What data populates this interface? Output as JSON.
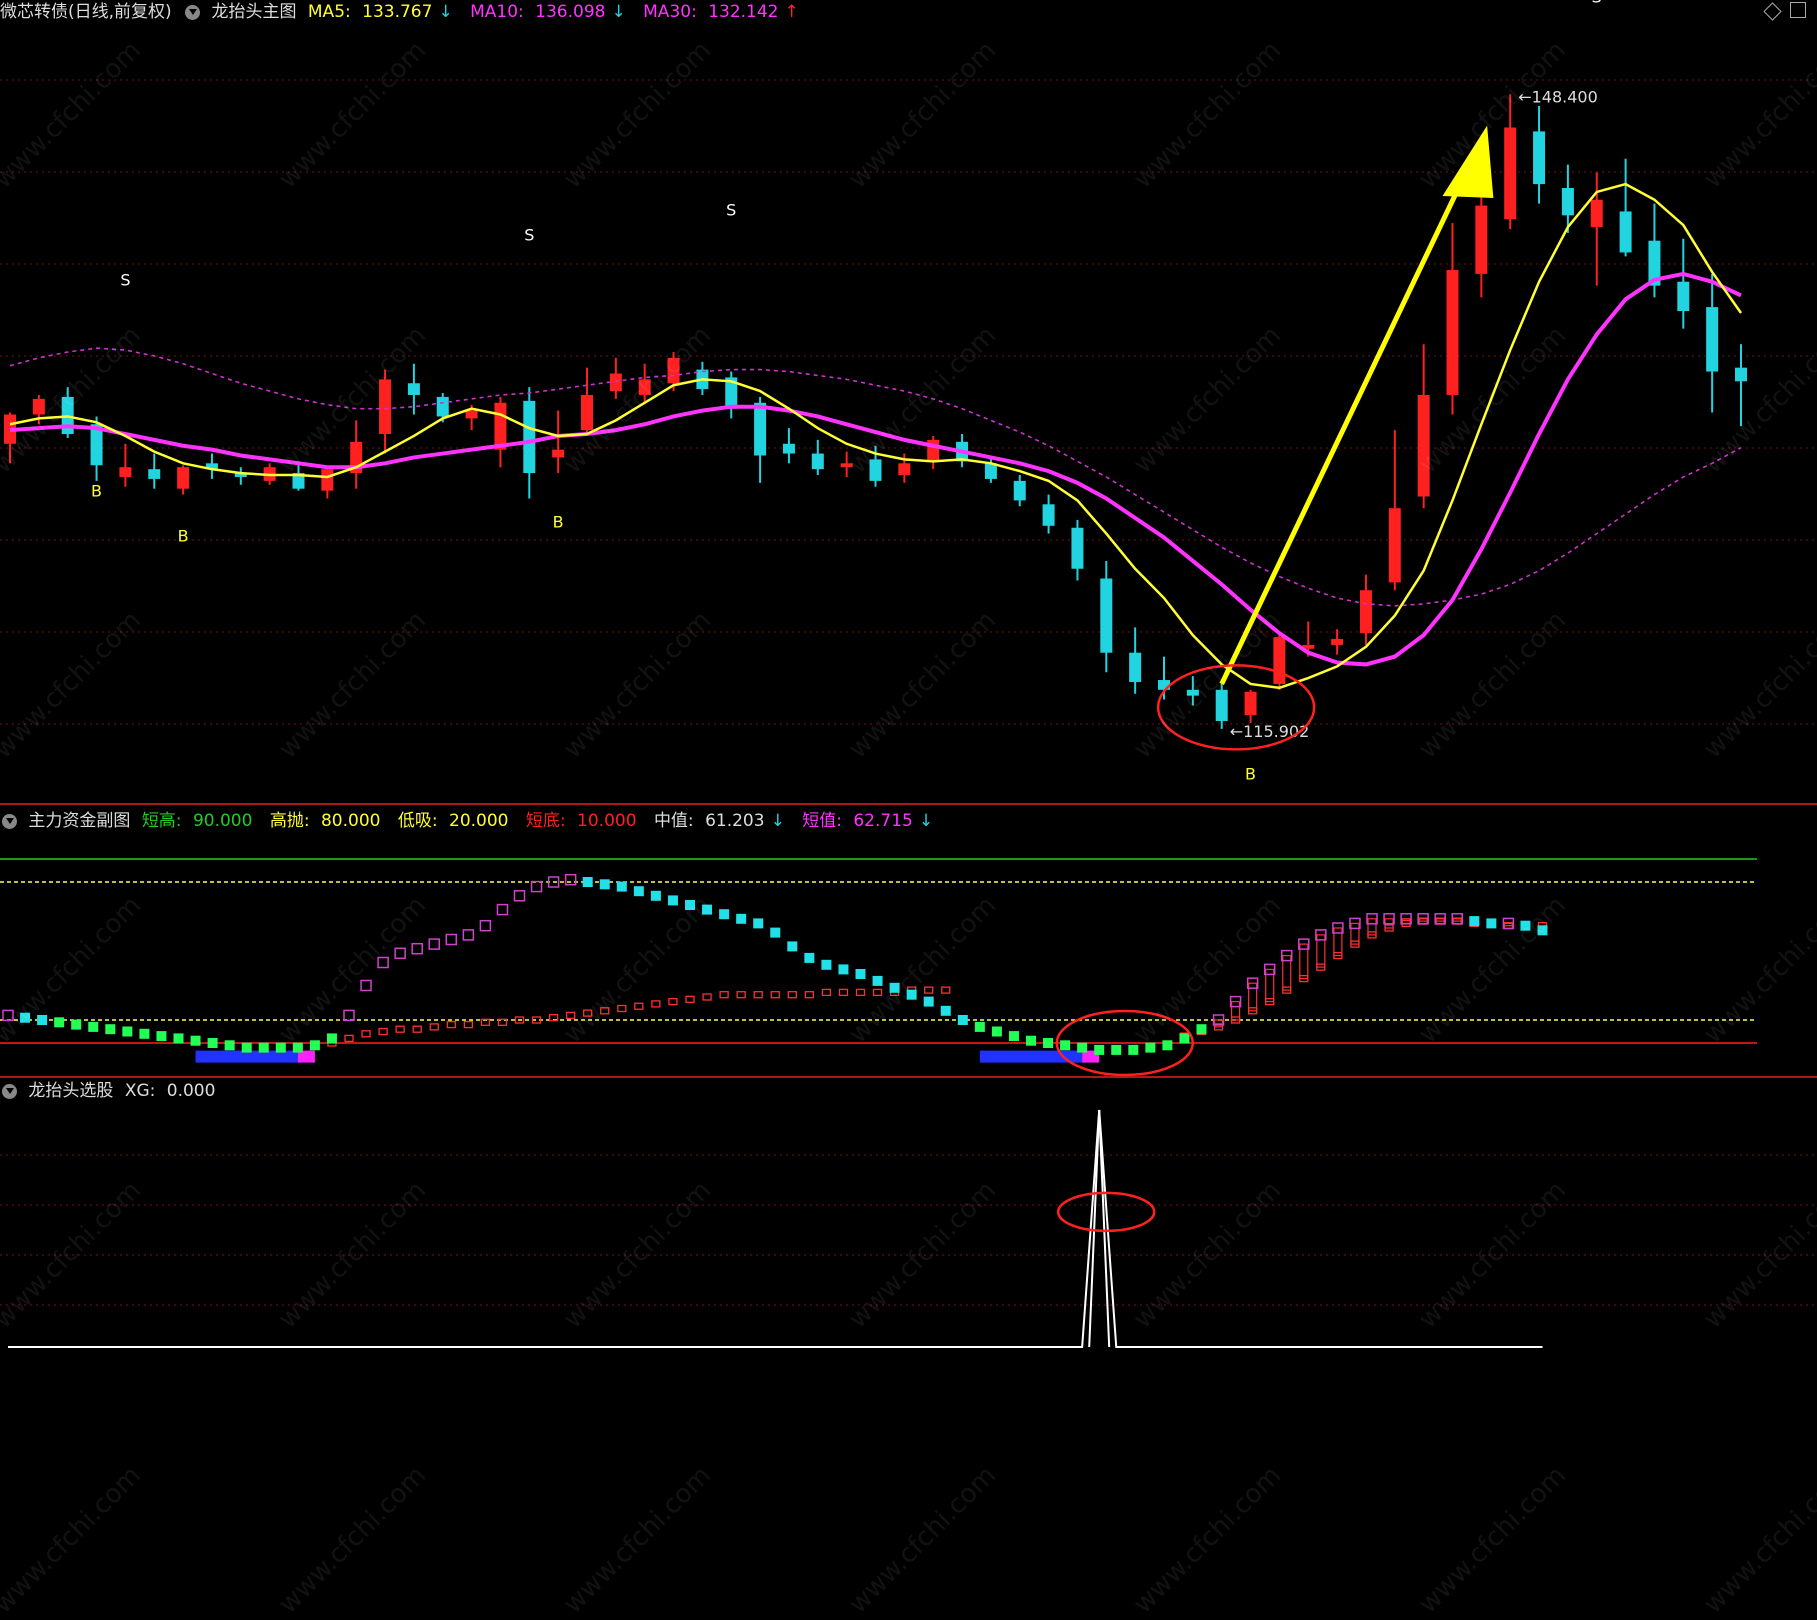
{
  "main_header": {
    "symbol": "微芯转债(日线,前复权)",
    "indicator": "龙抬头主图",
    "ma5_label": "MA5:",
    "ma5_value": "133.767",
    "ma5_arrow": "↓",
    "ma10_label": "MA10:",
    "ma10_value": "136.098",
    "ma10_arrow": "↓",
    "ma30_label": "MA30:",
    "ma30_value": "132.142",
    "ma30_arrow": "↑"
  },
  "sub_header": {
    "indicator": "主力资金副图",
    "short_high_label": "短高:",
    "short_high_value": "90.000",
    "high_sell_label": "高抛:",
    "high_sell_value": "80.000",
    "low_buy_label": "低吸:",
    "low_buy_value": "20.000",
    "short_bottom_label": "短底:",
    "short_bottom_value": "10.000",
    "mid_label": "中值:",
    "mid_value": "61.203",
    "mid_arrow": "↓",
    "short_label": "短值:",
    "short_value": "62.715",
    "short_arrow": "↓"
  },
  "xg_header": {
    "indicator": "龙抬头选股",
    "xg_label": "XG:",
    "xg_value": "0.000"
  },
  "watermark": "www.cfchi.com",
  "colors": {
    "up": "#ff2020",
    "down": "#22d3e0",
    "ma5": "#ffff33",
    "ma10": "#ff33ff",
    "ma30": "#cc33cc",
    "annot_circle": "#ff2020",
    "arrow": "#ffff00",
    "grid": "#7a1010"
  },
  "chart_data": [
    {
      "type": "candlestick",
      "name_shown": "龙抬头主图",
      "ylim": [
        112,
        152
      ],
      "price_labels": [
        {
          "text": "148.400",
          "index": 52,
          "value": 148.4
        },
        {
          "text": "115.902",
          "index": 42,
          "value": 115.9
        }
      ],
      "signals": [
        {
          "text": "S",
          "index": 4,
          "value": 138.6
        },
        {
          "text": "B",
          "index": 3,
          "value": 127.8
        },
        {
          "text": "B",
          "index": 6,
          "value": 125.5
        },
        {
          "text": "S",
          "index": 18,
          "value": 140.9
        },
        {
          "text": "B",
          "index": 19,
          "value": 126.2
        },
        {
          "text": "S",
          "index": 25,
          "value": 142.2
        },
        {
          "text": "B",
          "index": 43,
          "value": 113.3
        },
        {
          "text": "S",
          "index": 55,
          "value": 153.1
        }
      ],
      "candles": [
        {
          "o": 130.5,
          "h": 132.1,
          "l": 129.5,
          "c": 132.0
        },
        {
          "o": 132.0,
          "h": 133.0,
          "l": 131.5,
          "c": 132.8
        },
        {
          "o": 132.9,
          "h": 133.4,
          "l": 130.8,
          "c": 131.0
        },
        {
          "o": 131.5,
          "h": 131.9,
          "l": 128.6,
          "c": 129.4
        },
        {
          "o": 128.8,
          "h": 130.5,
          "l": 128.3,
          "c": 129.3
        },
        {
          "o": 129.2,
          "h": 130.0,
          "l": 128.2,
          "c": 128.7
        },
        {
          "o": 128.2,
          "h": 129.4,
          "l": 127.9,
          "c": 129.3
        },
        {
          "o": 129.5,
          "h": 130.0,
          "l": 128.7,
          "c": 129.2
        },
        {
          "o": 129.0,
          "h": 129.3,
          "l": 128.4,
          "c": 128.8
        },
        {
          "o": 128.6,
          "h": 129.5,
          "l": 128.4,
          "c": 129.3
        },
        {
          "o": 129.0,
          "h": 129.6,
          "l": 128.1,
          "c": 128.2
        },
        {
          "o": 128.1,
          "h": 129.2,
          "l": 127.7,
          "c": 129.2
        },
        {
          "o": 129.0,
          "h": 131.7,
          "l": 128.2,
          "c": 130.6
        },
        {
          "o": 131.0,
          "h": 134.3,
          "l": 130.0,
          "c": 133.8
        },
        {
          "o": 133.6,
          "h": 134.6,
          "l": 132.0,
          "c": 133.0
        },
        {
          "o": 132.9,
          "h": 133.1,
          "l": 131.6,
          "c": 131.9
        },
        {
          "o": 131.8,
          "h": 132.5,
          "l": 131.2,
          "c": 132.2
        },
        {
          "o": 130.2,
          "h": 132.9,
          "l": 129.3,
          "c": 132.6
        },
        {
          "o": 132.7,
          "h": 133.4,
          "l": 127.7,
          "c": 129.0
        },
        {
          "o": 129.8,
          "h": 132.2,
          "l": 129.0,
          "c": 130.2
        },
        {
          "o": 131.2,
          "h": 134.4,
          "l": 131.0,
          "c": 133.0
        },
        {
          "o": 133.2,
          "h": 134.9,
          "l": 132.8,
          "c": 134.1
        },
        {
          "o": 133.0,
          "h": 134.6,
          "l": 132.6,
          "c": 133.8
        },
        {
          "o": 133.6,
          "h": 135.2,
          "l": 133.2,
          "c": 134.9
        },
        {
          "o": 134.3,
          "h": 134.7,
          "l": 133.0,
          "c": 133.3
        },
        {
          "o": 133.9,
          "h": 134.2,
          "l": 131.8,
          "c": 132.3
        },
        {
          "o": 132.6,
          "h": 132.9,
          "l": 128.5,
          "c": 129.9
        },
        {
          "o": 130.5,
          "h": 131.3,
          "l": 129.5,
          "c": 130.0
        },
        {
          "o": 130.0,
          "h": 130.7,
          "l": 128.9,
          "c": 129.2
        },
        {
          "o": 129.3,
          "h": 130.1,
          "l": 128.8,
          "c": 129.5
        },
        {
          "o": 129.7,
          "h": 130.4,
          "l": 128.3,
          "c": 128.6
        },
        {
          "o": 128.9,
          "h": 130.0,
          "l": 128.5,
          "c": 129.5
        },
        {
          "o": 129.6,
          "h": 130.9,
          "l": 129.2,
          "c": 130.7
        },
        {
          "o": 130.6,
          "h": 131.0,
          "l": 129.3,
          "c": 129.6
        },
        {
          "o": 129.5,
          "h": 129.9,
          "l": 128.5,
          "c": 128.7
        },
        {
          "o": 128.6,
          "h": 128.9,
          "l": 127.3,
          "c": 127.6
        },
        {
          "o": 127.4,
          "h": 127.9,
          "l": 125.9,
          "c": 126.3
        },
        {
          "o": 126.2,
          "h": 126.6,
          "l": 123.5,
          "c": 124.1
        },
        {
          "o": 123.6,
          "h": 124.5,
          "l": 118.8,
          "c": 119.8
        },
        {
          "o": 119.8,
          "h": 121.1,
          "l": 117.7,
          "c": 118.3
        },
        {
          "o": 118.4,
          "h": 119.6,
          "l": 117.4,
          "c": 117.9
        },
        {
          "o": 117.9,
          "h": 118.6,
          "l": 117.1,
          "c": 117.6
        },
        {
          "o": 117.9,
          "h": 118.2,
          "l": 115.9,
          "c": 116.3
        },
        {
          "o": 116.6,
          "h": 117.9,
          "l": 116.2,
          "c": 117.8
        },
        {
          "o": 118.2,
          "h": 120.8,
          "l": 117.9,
          "c": 120.6
        },
        {
          "o": 120.0,
          "h": 121.4,
          "l": 119.6,
          "c": 120.2
        },
        {
          "o": 120.2,
          "h": 121.0,
          "l": 119.7,
          "c": 120.5
        },
        {
          "o": 120.8,
          "h": 123.8,
          "l": 120.2,
          "c": 123.0
        },
        {
          "o": 123.4,
          "h": 131.2,
          "l": 123.0,
          "c": 127.2
        },
        {
          "o": 127.8,
          "h": 135.6,
          "l": 127.2,
          "c": 133.0
        },
        {
          "o": 133.0,
          "h": 141.8,
          "l": 132.0,
          "c": 139.4
        },
        {
          "o": 139.2,
          "h": 144.2,
          "l": 138.0,
          "c": 142.7
        },
        {
          "o": 142.0,
          "h": 148.4,
          "l": 141.5,
          "c": 146.7
        },
        {
          "o": 146.5,
          "h": 147.8,
          "l": 142.8,
          "c": 143.8
        },
        {
          "o": 143.6,
          "h": 144.8,
          "l": 141.3,
          "c": 142.2
        },
        {
          "o": 141.6,
          "h": 144.4,
          "l": 138.6,
          "c": 143.0
        },
        {
          "o": 142.4,
          "h": 145.1,
          "l": 140.1,
          "c": 140.3
        },
        {
          "o": 140.9,
          "h": 142.8,
          "l": 138.0,
          "c": 138.6
        },
        {
          "o": 138.8,
          "h": 141.0,
          "l": 136.4,
          "c": 137.3
        },
        {
          "o": 137.5,
          "h": 139.2,
          "l": 132.1,
          "c": 134.2
        },
        {
          "o": 134.4,
          "h": 135.6,
          "l": 131.4,
          "c": 133.7
        }
      ],
      "ma5": [
        131.5,
        131.8,
        131.9,
        131.6,
        130.9,
        130.1,
        129.5,
        129.2,
        129.0,
        128.9,
        128.9,
        128.8,
        129.3,
        130.1,
        130.9,
        131.8,
        132.3,
        132.0,
        131.3,
        130.9,
        131.0,
        131.7,
        132.6,
        133.5,
        133.8,
        133.7,
        133.2,
        132.3,
        131.3,
        130.5,
        130.0,
        129.7,
        129.6,
        129.7,
        129.5,
        129.1,
        128.6,
        127.6,
        125.9,
        124.1,
        122.6,
        120.7,
        119.2,
        118.2,
        118.0,
        118.5,
        119.1,
        120.1,
        121.7,
        124.0,
        127.6,
        131.5,
        135.3,
        138.8,
        141.6,
        143.4,
        143.8,
        143.0,
        141.7,
        139.3,
        137.2
      ],
      "ma10": [
        131.2,
        131.3,
        131.4,
        131.3,
        131.0,
        130.7,
        130.4,
        130.2,
        129.9,
        129.7,
        129.5,
        129.3,
        129.3,
        129.5,
        129.8,
        130.0,
        130.2,
        130.4,
        130.6,
        130.9,
        131.0,
        131.2,
        131.5,
        131.9,
        132.2,
        132.4,
        132.4,
        132.2,
        131.9,
        131.5,
        131.1,
        130.7,
        130.4,
        130.1,
        129.8,
        129.5,
        129.1,
        128.5,
        127.7,
        126.7,
        125.7,
        124.5,
        123.3,
        122.0,
        120.8,
        119.8,
        119.3,
        119.2,
        119.6,
        120.7,
        122.5,
        125.1,
        128.0,
        131.0,
        133.8,
        136.1,
        137.9,
        138.9,
        139.2,
        138.8,
        138.1
      ],
      "ma30": [
        134.5,
        134.9,
        135.2,
        135.4,
        135.3,
        135.0,
        134.6,
        134.1,
        133.6,
        133.2,
        132.8,
        132.5,
        132.3,
        132.3,
        132.4,
        132.6,
        132.8,
        133.0,
        133.1,
        133.3,
        133.5,
        133.7,
        133.9,
        134.0,
        134.2,
        134.3,
        134.3,
        134.2,
        134.0,
        133.8,
        133.5,
        133.2,
        132.8,
        132.3,
        131.7,
        131.1,
        130.4,
        129.6,
        128.8,
        127.9,
        127.0,
        126.1,
        125.2,
        124.4,
        123.7,
        123.1,
        122.6,
        122.3,
        122.2,
        122.3,
        122.5,
        122.8,
        123.3,
        124.0,
        124.9,
        125.9,
        126.9,
        127.9,
        128.8,
        129.5,
        130.3
      ]
    },
    {
      "type": "bar",
      "name_shown": "主力资金副图",
      "ylim": [
        0,
        100
      ],
      "reference_lines": [
        {
          "label": "短高",
          "value": 90
        },
        {
          "label": "高抛",
          "value": 80
        },
        {
          "label": "低吸",
          "value": 20
        },
        {
          "label": "短底",
          "value": 10
        }
      ],
      "short_value": [
        22,
        21,
        20,
        19,
        18,
        17,
        16,
        15,
        14,
        13,
        12,
        11,
        10,
        9,
        8,
        8,
        8,
        8,
        9,
        12,
        22,
        35,
        45,
        49,
        51,
        53,
        55,
        57,
        61,
        68,
        74,
        78,
        80,
        81,
        80,
        79,
        78,
        76,
        74,
        72,
        70,
        68,
        66,
        64,
        62,
        58,
        52,
        47,
        44,
        42,
        40,
        37,
        34,
        31,
        28,
        24,
        20,
        17,
        15,
        13,
        11,
        10,
        9,
        8,
        7,
        7,
        7,
        8,
        9,
        12,
        16,
        20,
        28,
        36,
        42,
        48,
        53,
        57,
        60,
        62,
        64,
        64,
        64,
        64,
        64,
        64,
        63,
        62,
        62,
        61,
        59
      ],
      "mid_value": [
        null,
        null,
        null,
        null,
        null,
        null,
        null,
        null,
        null,
        null,
        null,
        null,
        null,
        null,
        null,
        null,
        null,
        null,
        null,
        10,
        12,
        14,
        15,
        16,
        16,
        17,
        18,
        18,
        19,
        19,
        20,
        20,
        21,
        22,
        23,
        24,
        25,
        26,
        27,
        28,
        29,
        30,
        31,
        31,
        31,
        31,
        31,
        31,
        32,
        32,
        32,
        32,
        32,
        33,
        33,
        33,
        null,
        null,
        null,
        null,
        null,
        null,
        null,
        null,
        null,
        null,
        null,
        null,
        null,
        13,
        15,
        17,
        20,
        24,
        28,
        33,
        38,
        43,
        48,
        53,
        57,
        60,
        62,
        63,
        63,
        63,
        62,
        62,
        61,
        61,
        61
      ],
      "blue_band": [
        [
          11,
          17
        ],
        [
          57,
          63
        ]
      ],
      "magenta_band": [
        [
          17,
          18
        ],
        [
          63,
          64
        ]
      ]
    },
    {
      "type": "line",
      "name_shown": "龙抬头选股",
      "ylim": [
        0,
        1
      ],
      "x": [
        0,
        63,
        64,
        65,
        90
      ],
      "values": [
        0,
        0,
        1,
        0,
        0
      ]
    }
  ]
}
